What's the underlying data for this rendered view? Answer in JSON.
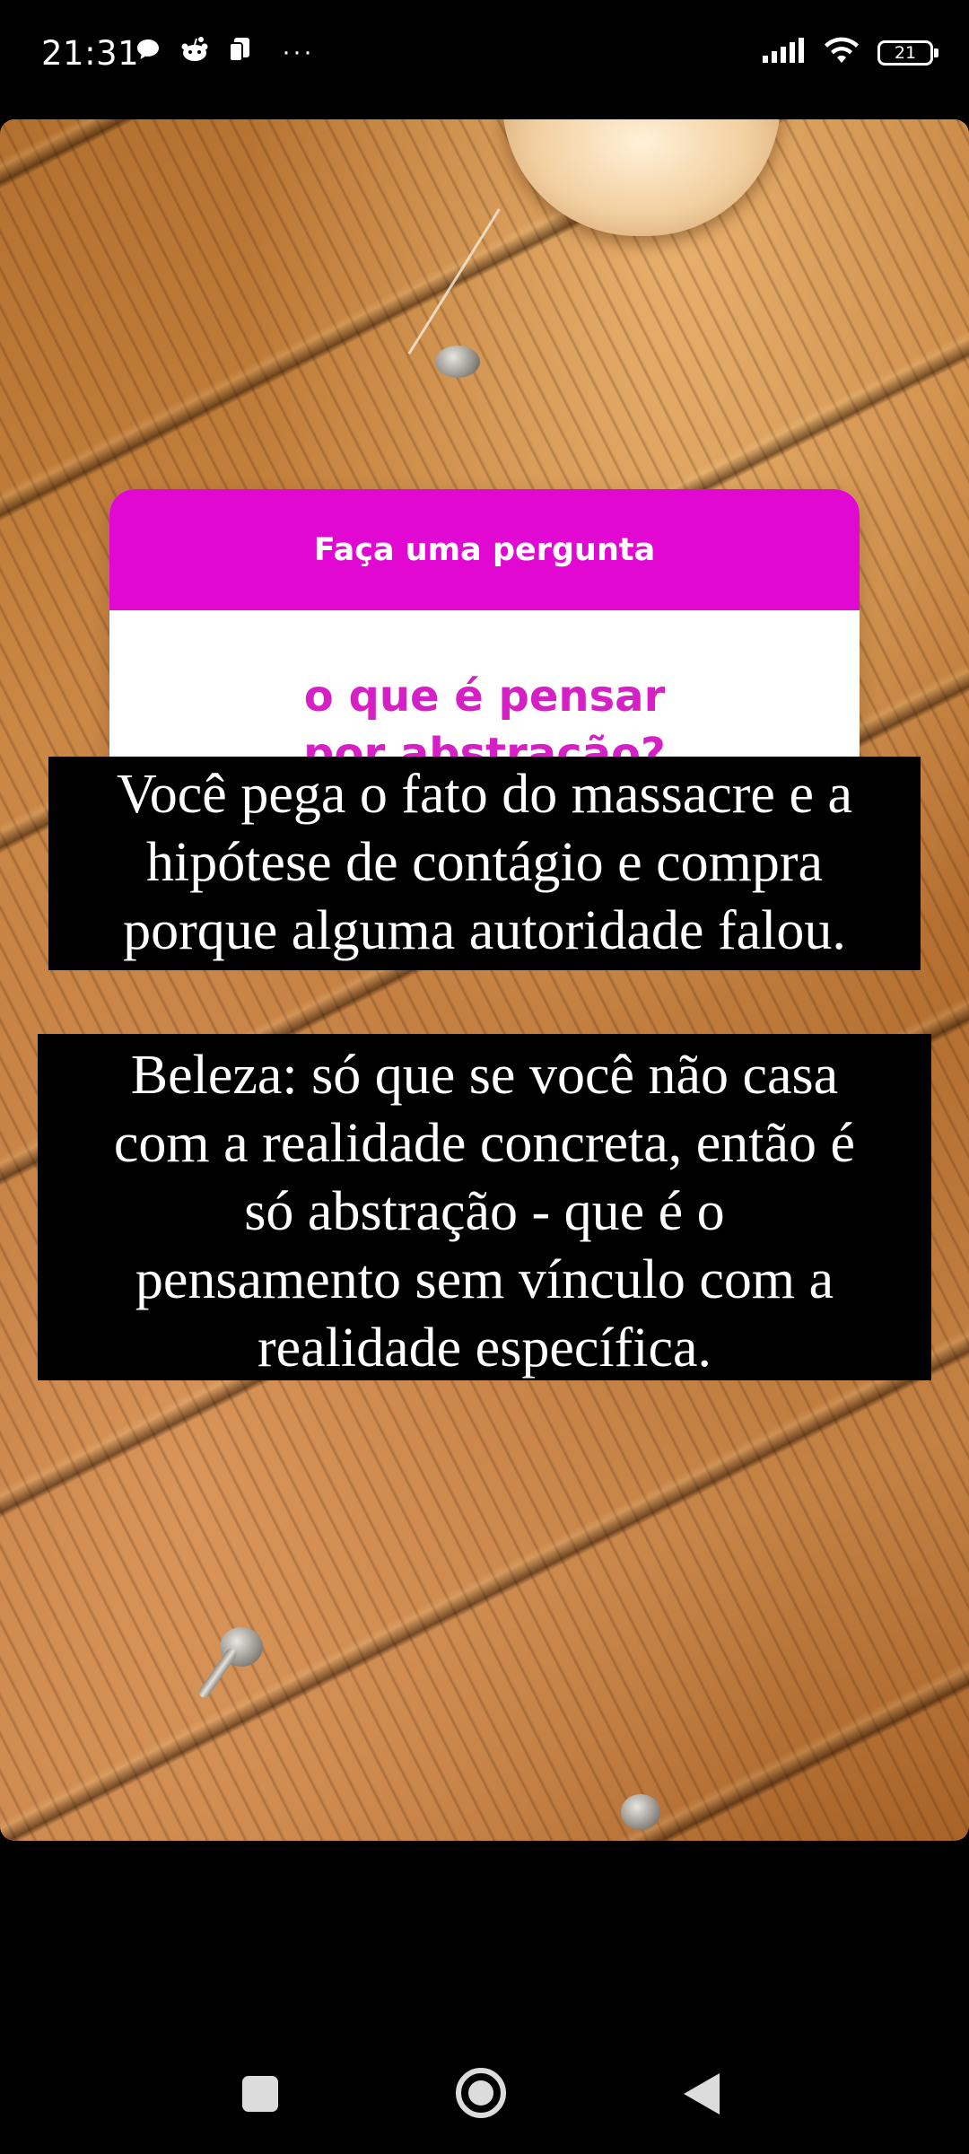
{
  "status_bar": {
    "time": "21:31",
    "more_indicator": "···",
    "battery_level": "21",
    "left_icons": [
      "chat-bubble-icon",
      "reddit-icon",
      "notification-card-icon"
    ],
    "right_icons": [
      "signal-icon",
      "wifi-icon",
      "battery-icon"
    ]
  },
  "story": {
    "question_sticker": {
      "header": "Faça uma pergunta",
      "answer": "o que é pensar\npor abstração?",
      "header_color": "#e108d2",
      "answer_color": "#d420c5"
    },
    "text_overlays": [
      {
        "text": "Você pega o fato do massacre e a\nhipótese de contágio e compra\nporque alguma autoridade falou."
      },
      {
        "text": "Beleza: só que se você não casa\ncom a realidade concreta, então é\nsó abstração - que é o\npensamento sem vínculo com a\nrealidade específica."
      }
    ]
  },
  "nav_bar": {
    "buttons": [
      "recent-apps",
      "home",
      "back"
    ]
  }
}
